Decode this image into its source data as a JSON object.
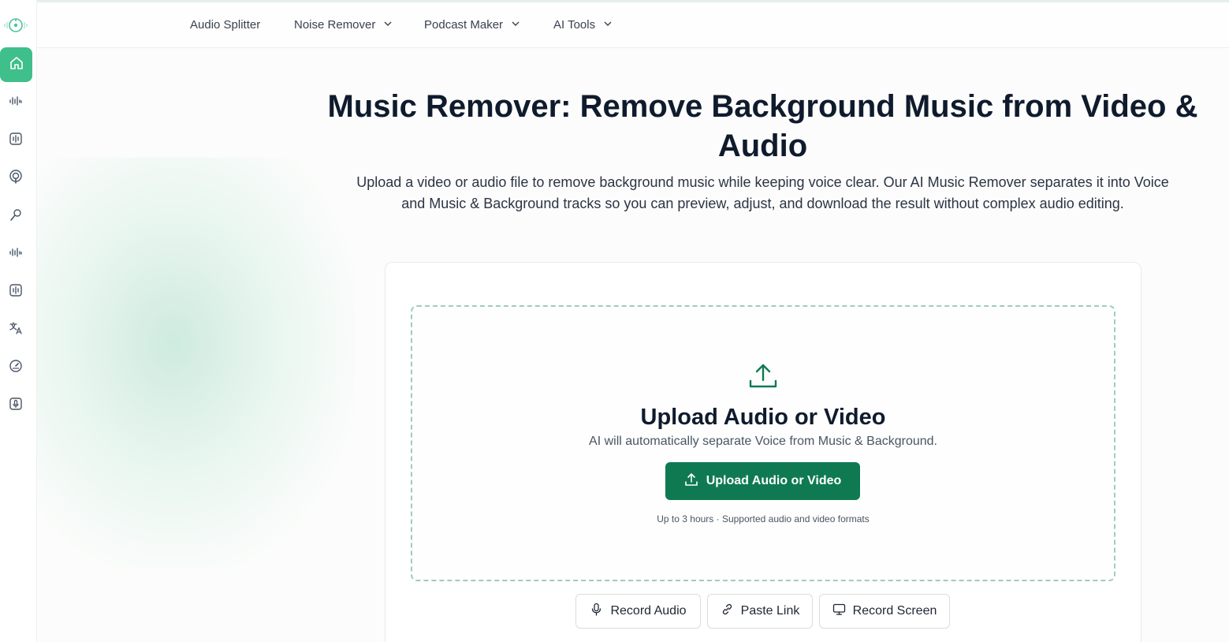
{
  "sidebar": {
    "logo": "soundwave-logo-icon",
    "items": [
      {
        "icon": "home-icon",
        "active": true
      },
      {
        "icon": "waveform-icon"
      },
      {
        "icon": "audio-box-icon"
      },
      {
        "icon": "podcast-icon"
      },
      {
        "icon": "microphone-tool-icon"
      },
      {
        "icon": "waveform-icon"
      },
      {
        "icon": "audio-box-icon"
      },
      {
        "icon": "translate-icon"
      },
      {
        "icon": "speedometer-icon"
      },
      {
        "icon": "voice-box-icon"
      }
    ]
  },
  "nav": {
    "items": [
      {
        "label": "Audio Splitter",
        "dropdown": false
      },
      {
        "label": "Noise Remover",
        "dropdown": true
      },
      {
        "label": "Podcast Maker",
        "dropdown": true
      },
      {
        "label": "AI Tools",
        "dropdown": true
      }
    ]
  },
  "hero": {
    "title": "Music Remover: Remove Background Music from Video & Audio",
    "subtitle": "Upload a video or audio file to remove background music while keeping voice clear. Our AI Music Remover separates it into Voice and Music & Background tracks so you can preview, adjust, and download the result without complex audio editing."
  },
  "upload": {
    "title": "Upload Audio or Video",
    "subtitle": "AI will automatically separate Voice from Music & Background.",
    "button_label": "Upload Audio or Video",
    "note": "Up to 3 hours · Supported audio and video formats"
  },
  "actions": {
    "record_audio": "Record Audio",
    "paste_link": "Paste Link",
    "record_screen": "Record Screen"
  },
  "colors": {
    "accent": "#0f7a52",
    "sidebar_active": "#3fbf8a",
    "dashed_border": "#9ccfb8"
  }
}
